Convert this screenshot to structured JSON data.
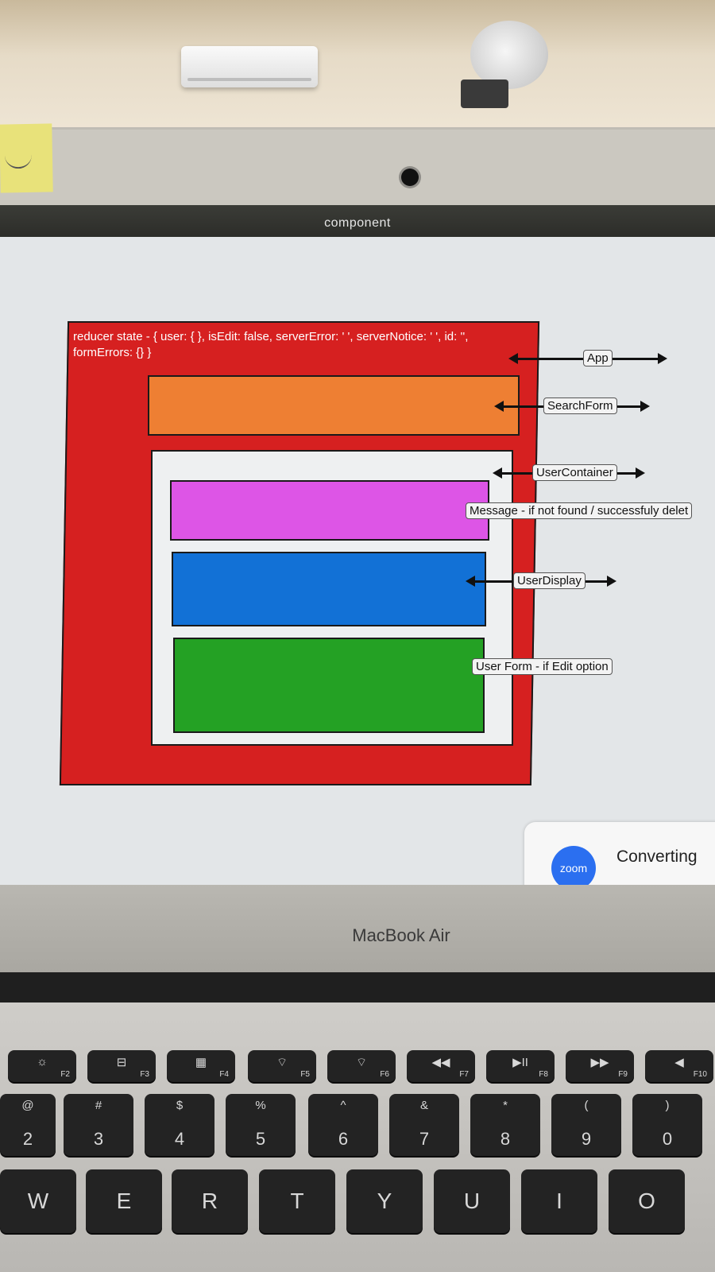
{
  "window": {
    "title": "component"
  },
  "diagram": {
    "state_text": "reducer state - { user: { }, isEdit: false, serverError: ' ', serverNotice: ' ', id: '', formErrors: {} }",
    "labels": {
      "app": "App",
      "search_form": "SearchForm",
      "user_container": "UserContainer",
      "message": "Message - if not found / successfuly delet",
      "user_display": "UserDisplay",
      "user_form": "User Form - if Edit option"
    },
    "colors": {
      "app": "#d62020",
      "search_form": "#ee7f33",
      "user_container": "#eef0f1",
      "message": "#dd55e6",
      "user_display": "#1271d6",
      "user_form": "#24a124"
    }
  },
  "zoom": {
    "logo": "zoom",
    "status": "Converting"
  },
  "laptop": {
    "brand": "MacBook Air"
  },
  "keyboard": {
    "fn_row": [
      {
        "icon": "☼",
        "label": "F2"
      },
      {
        "icon": "⊟",
        "label": "F3"
      },
      {
        "icon": "▦",
        "label": "F4"
      },
      {
        "icon": "⌔",
        "label": "F5"
      },
      {
        "icon": "⌔",
        "label": "F6"
      },
      {
        "icon": "◀◀",
        "label": "F7"
      },
      {
        "icon": "▶II",
        "label": "F8"
      },
      {
        "icon": "▶▶",
        "label": "F9"
      },
      {
        "icon": "◀",
        "label": "F10"
      }
    ],
    "num_row": [
      {
        "sym": "@",
        "num": "2"
      },
      {
        "sym": "#",
        "num": "3"
      },
      {
        "sym": "$",
        "num": "4"
      },
      {
        "sym": "%",
        "num": "5"
      },
      {
        "sym": "^",
        "num": "6"
      },
      {
        "sym": "&",
        "num": "7"
      },
      {
        "sym": "*",
        "num": "8"
      },
      {
        "sym": "(",
        "num": "9"
      },
      {
        "sym": ")",
        "num": "0"
      }
    ],
    "letter_row": [
      "W",
      "E",
      "R",
      "T",
      "Y",
      "U",
      "I",
      "O"
    ]
  }
}
